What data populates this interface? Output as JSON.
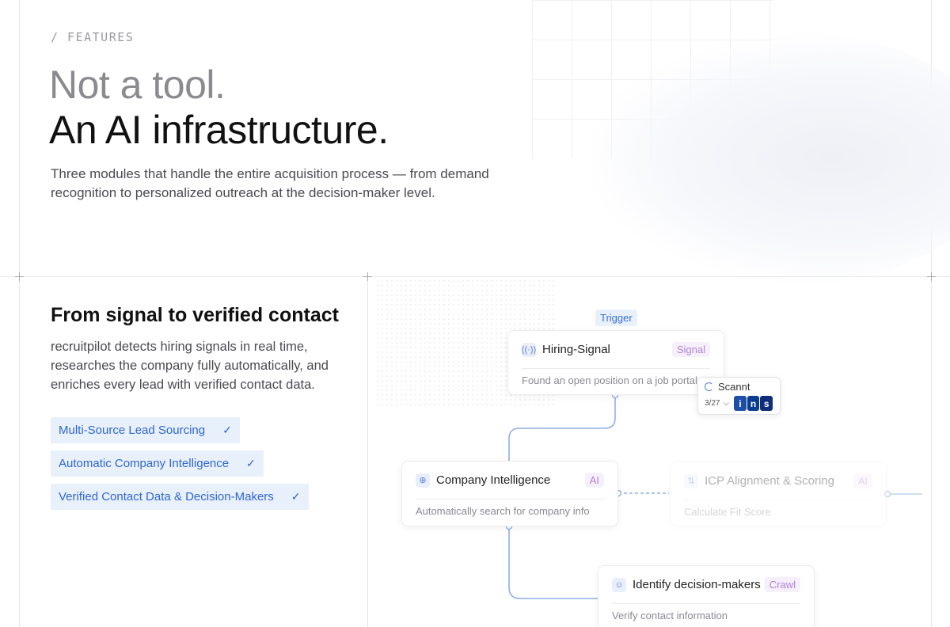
{
  "hero": {
    "eyebrow": "/ FEATURES",
    "title_line1": "Not a tool.",
    "title_line2": "An AI infrastructure.",
    "lead": "Three modules that handle the entire acquisition process — from demand recognition to personalized outreach at the decision-maker level."
  },
  "section": {
    "title": "From signal to verified contact",
    "body": "recruitpilot detects hiring signals in real time, researches the company fully automatically, and enriches every lead with verified contact data.",
    "features": [
      {
        "label": "Multi-Source Lead Sourcing",
        "check": "✓"
      },
      {
        "label": "Automatic Company Intelligence",
        "check": "✓"
      },
      {
        "label": "Verified Contact Data & Decision-Makers",
        "check": "✓"
      }
    ]
  },
  "flow": {
    "trigger_label": "Trigger",
    "nodes": [
      {
        "title": "Hiring-Signal",
        "tag": "Signal",
        "sub": "Found an open position on a job portal",
        "icon": "broadcast-icon",
        "glyph": "((·))"
      },
      {
        "title": "Company Intelligence",
        "tag": "AI",
        "sub": "Automatically search for company info",
        "icon": "globe-icon",
        "glyph": "⊕"
      },
      {
        "title": "ICP Alignment & Scoring",
        "tag": "AI",
        "sub": "Calculate Fit Score",
        "icon": "refresh-icon",
        "glyph": "⇅"
      },
      {
        "title": "Identify decision-makers",
        "tag": "Crawl",
        "sub": "Verify contact information",
        "icon": "user-icon",
        "glyph": "☺"
      }
    ],
    "scan": {
      "label": "Scannt",
      "counter": "3/27",
      "chevron": "⌵",
      "sources": [
        {
          "letter": "i",
          "color": "#1d4fa8"
        },
        {
          "letter": "n",
          "color": "#0a3d91"
        },
        {
          "letter": "s",
          "color": "#0f2e7a"
        }
      ]
    }
  },
  "colors": {
    "accent": "#2f66d0",
    "tag": "#b182d8",
    "connector": "#8fb0e6"
  }
}
